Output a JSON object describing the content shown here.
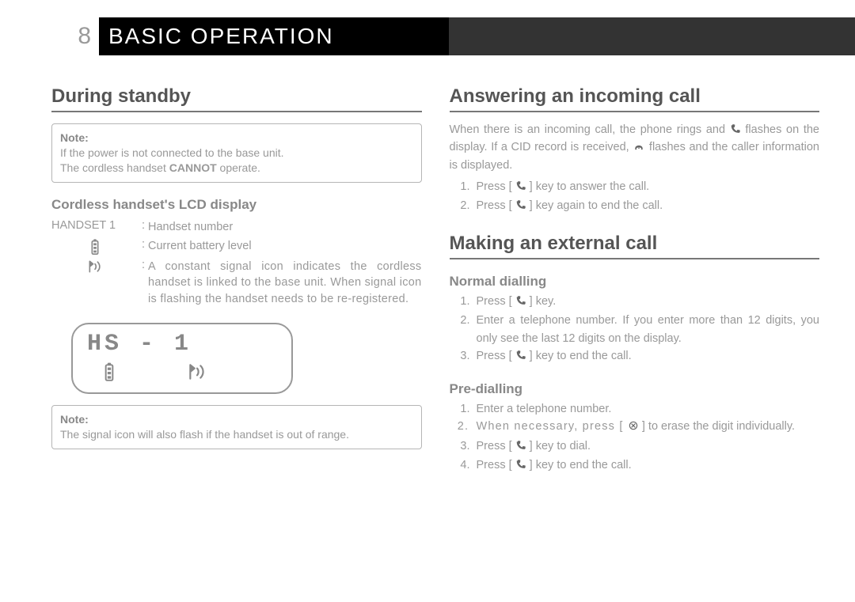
{
  "header": {
    "page_number": "8",
    "chapter_title": "BASIC OPERATION"
  },
  "left": {
    "h2_standby": "During standby",
    "note1_label": "Note",
    "note1_line1": "If the power is not connected to the base unit.",
    "note1_line2": "The cordless handset ",
    "note1_bold": "CANNOT",
    "note1_line2b": " operate.",
    "h3_lcd": "Cordless handset's LCD display",
    "lcd_handset_key": "HANDSET 1",
    "lcd_handset_val": "Handset number",
    "lcd_batt_val": "Current battery level",
    "lcd_sig_val": "A constant signal icon indicates the cordless handset is linked to the base unit. When signal icon is flashing the handset needs to be re-registered.",
    "lcd_screen_text": "HS - 1",
    "note2_label": "Note",
    "note2_text": "The signal icon will also flash if the handset is out of range."
  },
  "right": {
    "h2_answer": "Answering an incoming call",
    "answer_para_a": "When there is an incoming call, the phone rings and ",
    "answer_para_b": " flashes on the display. If a CID record is received, ",
    "answer_para_c": " flashes and the caller information is displayed.",
    "answer_step1_a": "Press [ ",
    "answer_step1_b": " ] key to answer the call.",
    "answer_step2_a": "Press [ ",
    "answer_step2_b": " ] key again to end the call.",
    "h2_make": "Making an external call",
    "h3_normal": "Normal dialling",
    "normal_step1_a": "Press [ ",
    "normal_step1_b": " ] key.",
    "normal_step2": "Enter a telephone number. If you enter more than 12 digits, you only see the last 12 digits on the display.",
    "normal_step3_a": "Press [ ",
    "normal_step3_b": " ] key to end the call.",
    "h3_pre": "Pre-dialling",
    "pre_step1": "Enter a telephone number.",
    "pre_step2_a": "When necessary, press [ ",
    "pre_step2_b": " ] to erase the digit individually.",
    "pre_step3_a": "Press [ ",
    "pre_step3_b": " ] key to dial.",
    "pre_step4_a": "Press [ ",
    "pre_step4_b": " ] key to end the call."
  }
}
